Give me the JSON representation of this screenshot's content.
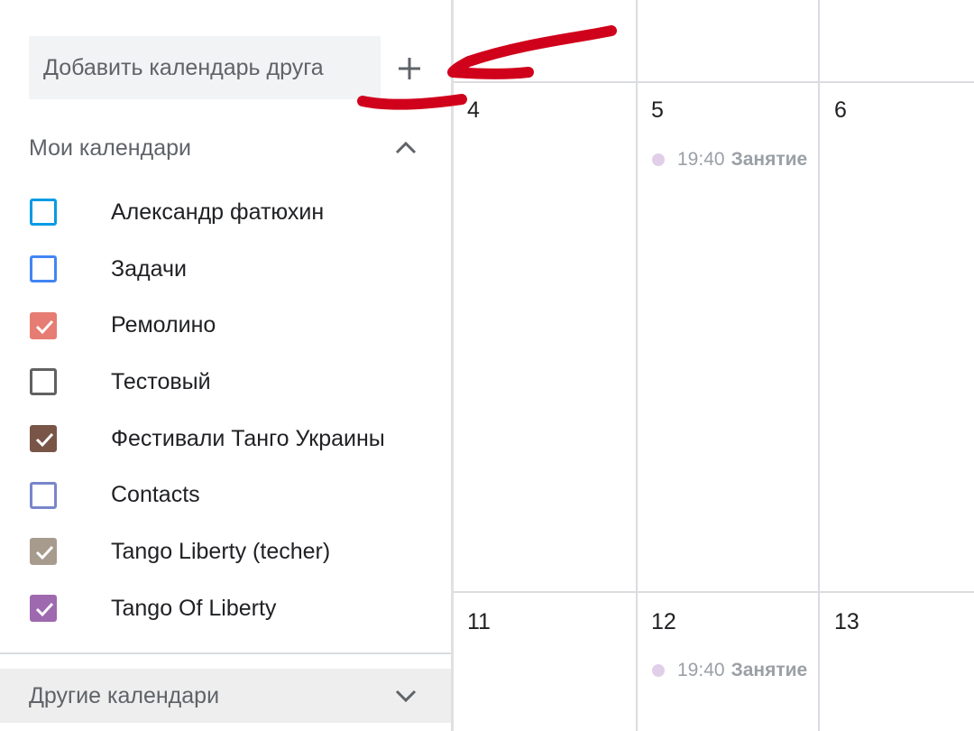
{
  "sidebar": {
    "add_friend_placeholder": "Добавить календарь друга",
    "my_calendars_title": "Мои календари",
    "other_calendars_title": "Другие календари",
    "calendars": [
      {
        "label": "Александр фатюхин",
        "color": "#039be5",
        "checked": false
      },
      {
        "label": "Задачи",
        "color": "#4285f4",
        "checked": false
      },
      {
        "label": "Ремолино",
        "color": "#e67c73",
        "checked": true
      },
      {
        "label": "Тестовый",
        "color": "#616161",
        "checked": false
      },
      {
        "label": "Фестивали Танго Украины",
        "color": "#795548",
        "checked": true
      },
      {
        "label": "Contacts",
        "color": "#7986cb",
        "checked": false
      },
      {
        "label": "Tango Liberty (techer)",
        "color": "#a79b8e",
        "checked": true
      },
      {
        "label": "Tango Of Liberty",
        "color": "#9e69af",
        "checked": true
      }
    ]
  },
  "grid": {
    "days": [
      "4",
      "5",
      "6",
      "11",
      "12",
      "13"
    ],
    "events": [
      {
        "time": "19:40",
        "title": "Занятие",
        "color": "#e1cfe9"
      },
      {
        "time": "19:40",
        "title": "Занятие",
        "color": "#e1cfe9"
      }
    ]
  },
  "annotation": {
    "color": "#d0021b"
  }
}
